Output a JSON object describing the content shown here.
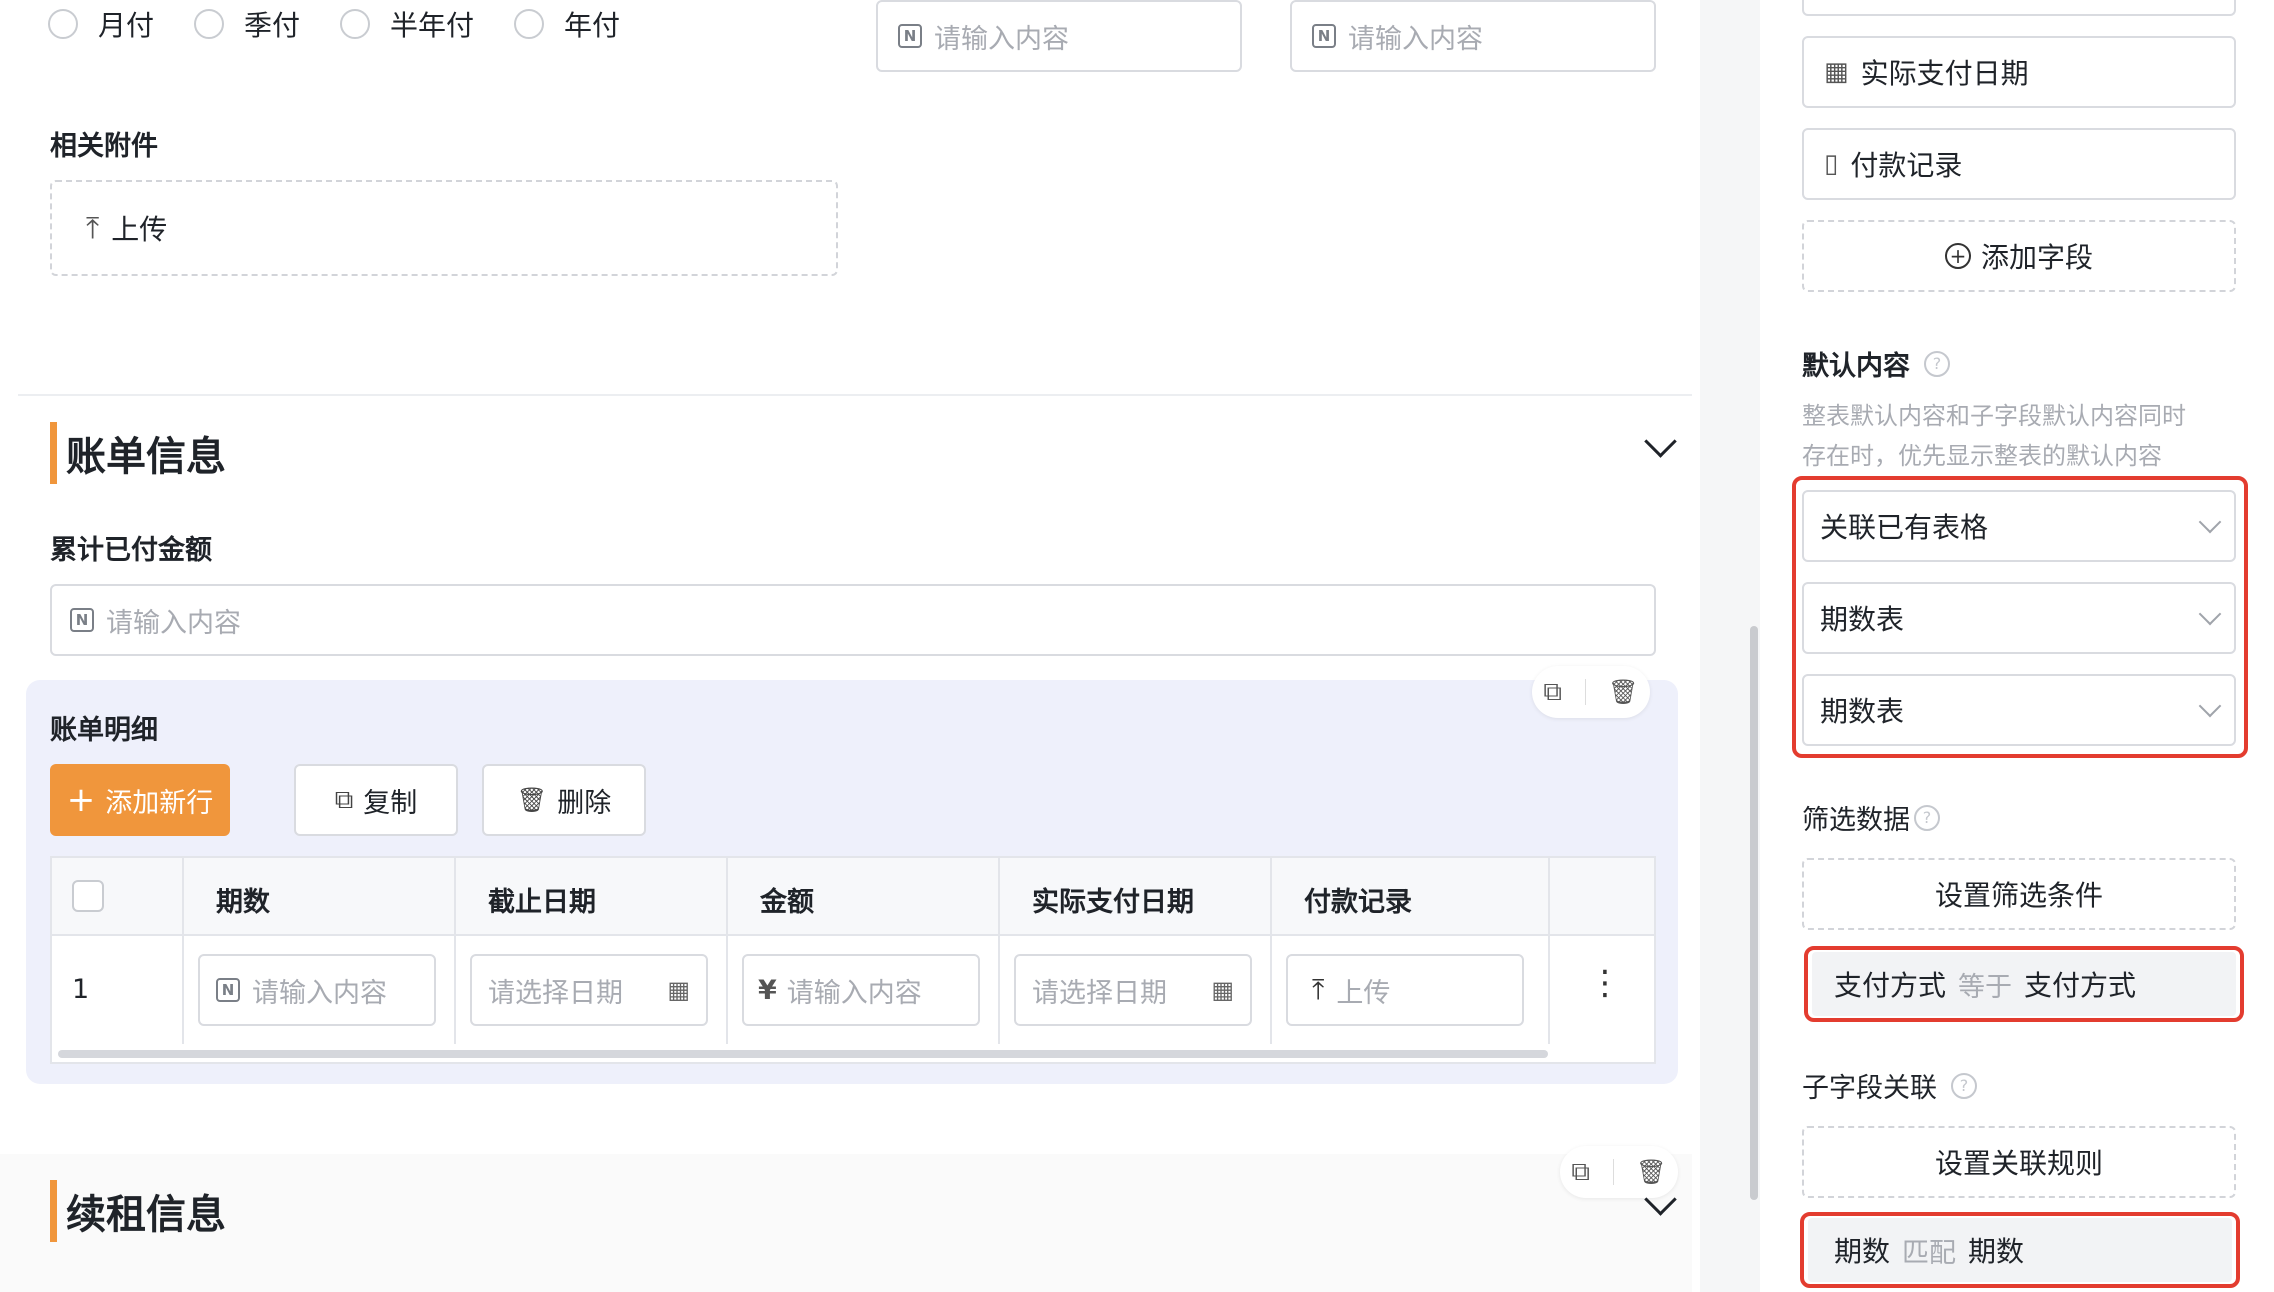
{
  "payment_cycle": {
    "options": [
      "月付",
      "季付",
      "半年付",
      "年付"
    ]
  },
  "top_inputs": {
    "placeholder": "请输入内容"
  },
  "attachments": {
    "label": "相关附件",
    "upload": "上传"
  },
  "bill_section": {
    "title": "账单信息",
    "paid_total_label": "累计已付金额",
    "paid_total_placeholder": "请输入内容"
  },
  "bill_detail": {
    "title": "账单明细",
    "add_row": "添加新行",
    "copy": "复制",
    "delete": "删除",
    "columns": [
      "期数",
      "截止日期",
      "金额",
      "实际支付日期",
      "付款记录"
    ],
    "row": {
      "index": "1",
      "period_placeholder": "请输入内容",
      "deadline_placeholder": "请选择日期",
      "amount_prefix": "¥",
      "amount_placeholder": "请输入内容",
      "paid_date_placeholder": "请选择日期",
      "record_upload": "上传"
    }
  },
  "renew_section": {
    "title": "续租信息"
  },
  "right_panel": {
    "fields": [
      "实际支付日期",
      "付款记录"
    ],
    "add_field": "添加字段",
    "default_content": {
      "title": "默认内容",
      "desc_line1": "整表默认内容和子字段默认内容同时",
      "desc_line2": "存在时，优先显示整表的默认内容",
      "selects": [
        "关联已有表格",
        "期数表",
        "期数表"
      ]
    },
    "filter": {
      "title": "筛选数据",
      "button": "设置筛选条件",
      "rule": {
        "left": "支付方式",
        "op": "等于",
        "right": "支付方式"
      }
    },
    "subfield": {
      "title": "子字段关联",
      "button": "设置关联规则",
      "rule": {
        "left": "期数",
        "op": "匹配",
        "right": "期数"
      }
    }
  },
  "colors": {
    "accent": "#f0963c",
    "highlight": "#e33c2f",
    "detail_bg": "#eef0fb"
  }
}
